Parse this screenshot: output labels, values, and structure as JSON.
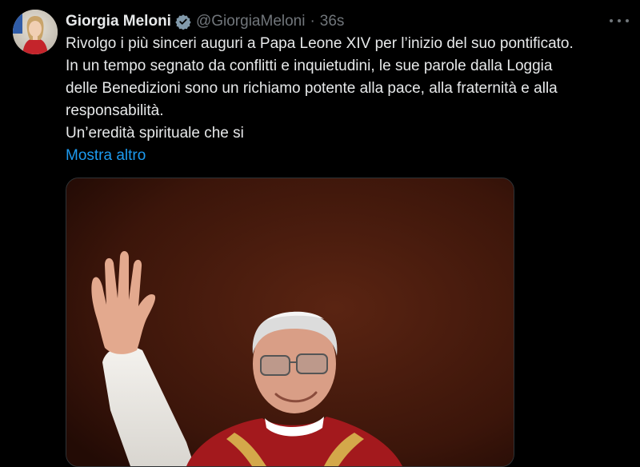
{
  "tweet": {
    "author": {
      "name": "Giorgia Meloni",
      "handle": "@GiorgiaMeloni",
      "separator": "·",
      "time": "36s"
    },
    "text_lines": [
      "Rivolgo i più sinceri auguri a Papa Leone XIV per l’inizio del suo pontificato.",
      "In un tempo segnato da conflitti e inquietudini, le sue parole dalla Loggia",
      "delle Benedizioni sono un richiamo potente alla pace, alla fraternità e alla",
      "responsabilità.",
      "Un’eredità spirituale che si"
    ],
    "show_more": "Mostra altro",
    "icons": {
      "verified": "verified-badge-icon",
      "more": "more-options-icon"
    },
    "colors": {
      "background": "#000000",
      "text": "#e7e9ea",
      "muted": "#71767b",
      "link": "#1d9bf0"
    }
  }
}
